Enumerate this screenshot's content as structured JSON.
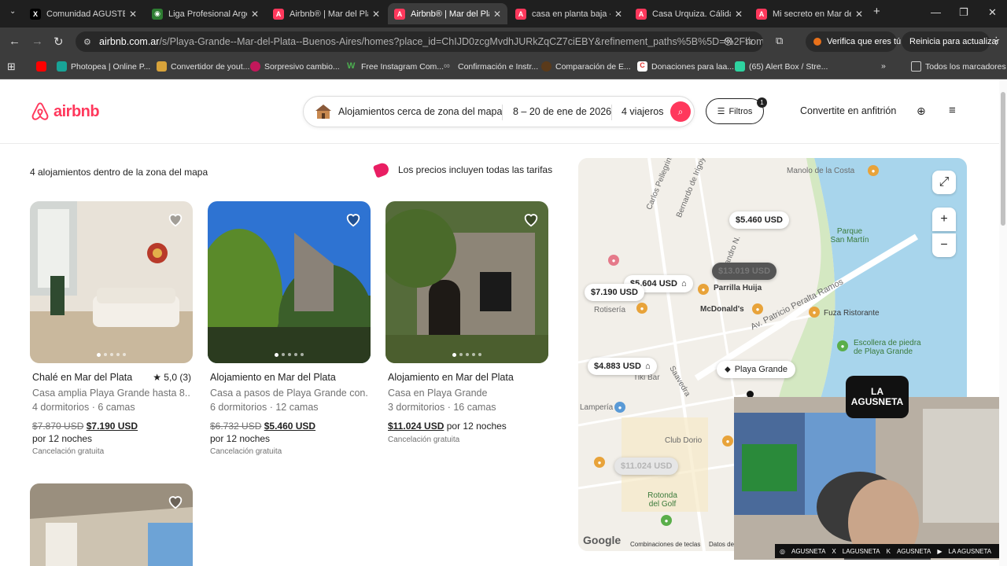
{
  "browser": {
    "tabs": [
      {
        "title": "Comunidad AGUSTETI",
        "icon": "x-logo-icon"
      },
      {
        "title": "Liga Profesional Argen",
        "icon": "globe-green-icon"
      },
      {
        "title": "Airbnb® | Mar del Plat",
        "icon": "airbnb-icon"
      },
      {
        "title": "Airbnb® | Mar del Plat",
        "icon": "airbnb-icon"
      },
      {
        "title": "casa en planta baja - C",
        "icon": "airbnb-icon"
      },
      {
        "title": "Casa Urquiza. Cálida. C",
        "icon": "airbnb-icon"
      },
      {
        "title": "Mi secreto en Mar del",
        "icon": "airbnb-icon"
      }
    ],
    "active_tab": 3,
    "url_domain": "airbnb.com.ar",
    "url_path": "/s/Playa-Grande--Mar-del-Plata--Buenos-Aires/homes?place_id=ChIJD0zcgMvdhJURkZqCZ7ciEBY&refinement_paths%5B%5D=%2Fhomes&ch...",
    "verify_label": "Verifica que eres tú",
    "update_label": "Reinicia para actualizar",
    "bookmarks": [
      {
        "label": "",
        "icon": "youtube-icon"
      },
      {
        "label": "Photopea | Online P...",
        "icon": "photopea-icon"
      },
      {
        "label": "Convertidor de yout...",
        "icon": "converter-icon"
      },
      {
        "label": "Sorpresivo cambio...",
        "icon": "news-icon"
      },
      {
        "label": "Free Instagram Com...",
        "icon": "w-icon"
      },
      {
        "label": "Confirmación e Instr...",
        "icon": "link-icon"
      },
      {
        "label": "Comparación de E...",
        "icon": "compare-icon"
      },
      {
        "label": "Donaciones para laa...",
        "icon": "c-icon"
      },
      {
        "label": "(65) Alert Box / Stre...",
        "icon": "alert-icon"
      }
    ],
    "all_bookmarks": "Todos los marcadores"
  },
  "header": {
    "logo": "airbnb",
    "search_location": "Alojamientos cerca de zona del mapa",
    "search_dates": "8 – 20 de ene de 2026",
    "search_guests": "4 viajeros",
    "filters_label": "Filtros",
    "filters_count": "1",
    "host_label": "Convertite en anfitrión"
  },
  "results": {
    "count_text": "4 alojamientos dentro de la zona del mapa",
    "prices_note": "Los precios incluyen todas las tarifas",
    "listings": [
      {
        "title": "Chalé en Mar del Plata",
        "rating": "★ 5,0 (3)",
        "subtitle": "Casa amplia Playa Grande hasta 8....",
        "rooms": "4 dormitorios · 6 camas",
        "old_price": "$7.870 USD",
        "price": "$7.190 USD",
        "nights": "por 12 noches",
        "cancel": "Cancelación gratuita"
      },
      {
        "title": "Alojamiento en Mar del Plata",
        "rating": "",
        "subtitle": "Casa a pasos de Playa Grande con...",
        "rooms": "6 dormitorios · 12 camas",
        "old_price": "$6.732 USD",
        "price": "$5.460 USD",
        "nights": "por 12 noches",
        "cancel": "Cancelación gratuita"
      },
      {
        "title": "Alojamiento en Mar del Plata",
        "rating": "",
        "subtitle": "Casa en Playa Grande",
        "rooms": "3 dormitorios · 16 camas",
        "old_price": "",
        "price": "$11.024 USD",
        "nights": "por 12 noches",
        "cancel": "Cancelación gratuita"
      }
    ]
  },
  "map": {
    "price_pins": [
      "$5.460 USD",
      "$13.019 USD",
      "$5.604 USD",
      "$7.190 USD",
      "$4.883 USD",
      "$11.024 USD"
    ],
    "labels": [
      "Manolo de la Costa",
      "Parque San Martín",
      "Parrilla Huija",
      "McDonald's",
      "Fuza Ristorante",
      "Escollera de piedra de Playa Grande",
      "Rotonda del Golf",
      "Playa Grande",
      "Bernardo de Irigoyen",
      "Leandro N.",
      "Av. Patricio Peralta Ramos",
      "Carlos Pellegrini",
      "Rotisería",
      "Saavedra",
      "Tiki Bar",
      "Club Dorio",
      "Lampería"
    ],
    "footer": [
      "Google",
      "Combinaciones de teclas",
      "Datos de"
    ]
  },
  "overlay": {
    "brand": "LA AGUSNETA",
    "socials": [
      "AGUSNETA",
      "LAGUSNETA",
      "AGUSNETA",
      "LA AGUSNETA"
    ]
  }
}
